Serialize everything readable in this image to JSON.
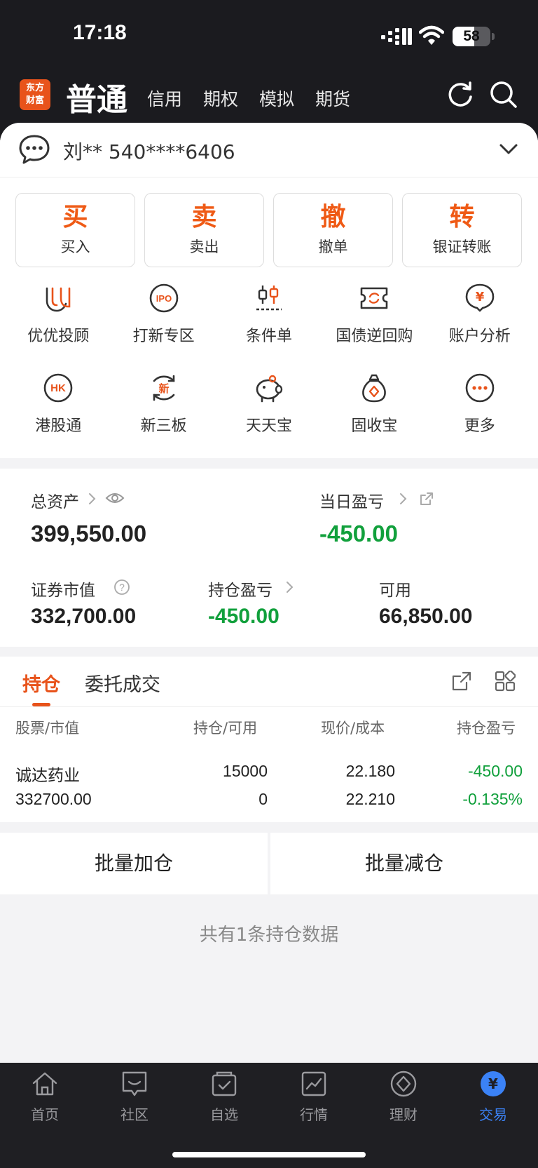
{
  "status": {
    "time": "17:18",
    "battery": "58",
    "battery_level": 0.58
  },
  "header": {
    "brand_line1": "东方",
    "brand_line2": "财富",
    "title": "普通",
    "tabs": [
      "信用",
      "期权",
      "模拟",
      "期货"
    ]
  },
  "account": {
    "name": "刘** 540****6406"
  },
  "actions": [
    {
      "big": "买",
      "label": "买入"
    },
    {
      "big": "卖",
      "label": "卖出"
    },
    {
      "big": "撤",
      "label": "撤单"
    },
    {
      "big": "转",
      "label": "银证转账"
    }
  ],
  "grid": [
    [
      {
        "icon": "u-advisor-icon",
        "label": "优优投顾"
      },
      {
        "icon": "ipo-icon",
        "label": "打新专区"
      },
      {
        "icon": "condition-order-icon",
        "label": "条件单"
      },
      {
        "icon": "repo-icon",
        "label": "国债逆回购"
      },
      {
        "icon": "account-analysis-icon",
        "label": "账户分析"
      }
    ],
    [
      {
        "icon": "hk-icon",
        "label": "港股通"
      },
      {
        "icon": "new-third-board-icon",
        "label": "新三板"
      },
      {
        "icon": "piggy-bank-icon",
        "label": "天天宝"
      },
      {
        "icon": "money-bag-icon",
        "label": "固收宝"
      },
      {
        "icon": "more-icon",
        "label": "更多"
      }
    ]
  ],
  "assets": {
    "total_label": "总资产",
    "total_value": "399,550.00",
    "daily_label": "当日盈亏",
    "daily_value": "-450.00",
    "market_label": "证券市值",
    "market_value": "332,700.00",
    "pnl_label": "持仓盈亏",
    "pnl_value": "-450.00",
    "avail_label": "可用",
    "avail_value": "66,850.00"
  },
  "holdings": {
    "tab_active": "持仓",
    "tab_other": "委托成交",
    "headers": [
      "股票/市值",
      "持仓/可用",
      "现价/成本",
      "持仓盈亏"
    ],
    "rows": [
      {
        "name": "诚达药业",
        "value": "332700.00",
        "qty": "15000",
        "avail": "0",
        "price": "22.180",
        "cost": "22.210",
        "pnl": "-450.00",
        "pnl_pct": "-0.135%"
      }
    ]
  },
  "batch": {
    "add": "批量加仓",
    "reduce": "批量减仓"
  },
  "count_text": "共有1条持仓数据",
  "tabbar": [
    {
      "icon": "home-icon",
      "label": "首页"
    },
    {
      "icon": "community-icon",
      "label": "社区"
    },
    {
      "icon": "watchlist-icon",
      "label": "自选"
    },
    {
      "icon": "market-icon",
      "label": "行情"
    },
    {
      "icon": "wealth-icon",
      "label": "理财"
    },
    {
      "icon": "trade-icon",
      "label": "交易"
    }
  ],
  "colors": {
    "accent": "#e8531b",
    "loss_green": "#11a03c",
    "tab_active": "#3b82f6"
  }
}
